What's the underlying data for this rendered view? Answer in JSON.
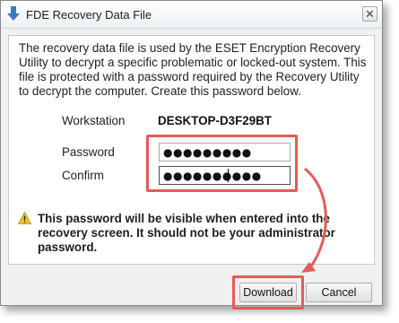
{
  "window": {
    "title": "FDE Recovery Data File",
    "close_glyph": "✕",
    "title_icon": "download-arrow-icon"
  },
  "body": {
    "intro": "The recovery data file is used by the ESET Encryption Recovery Utility to decrypt a specific problematic or locked-out system. This file is protected with a password required by the Recovery Utility to decrypt the computer. Create this password below.",
    "workstation_label": "Workstation",
    "workstation_value": "DESKTOP-D3F29BT",
    "password_label": "Password",
    "password_value": "●●●●●●●●●",
    "confirm_label": "Confirm",
    "confirm_value": "●●●●●●●●●●",
    "warning": "This password will be visible when entered into the recovery screen. It should not be your administrator password.",
    "warning_icon": "warning-icon"
  },
  "buttons": {
    "download": "Download",
    "cancel": "Cancel"
  },
  "colors": {
    "highlight": "#e65a5a",
    "title_icon_blue": "#3a78c8",
    "warning_yellow": "#f3c623"
  }
}
